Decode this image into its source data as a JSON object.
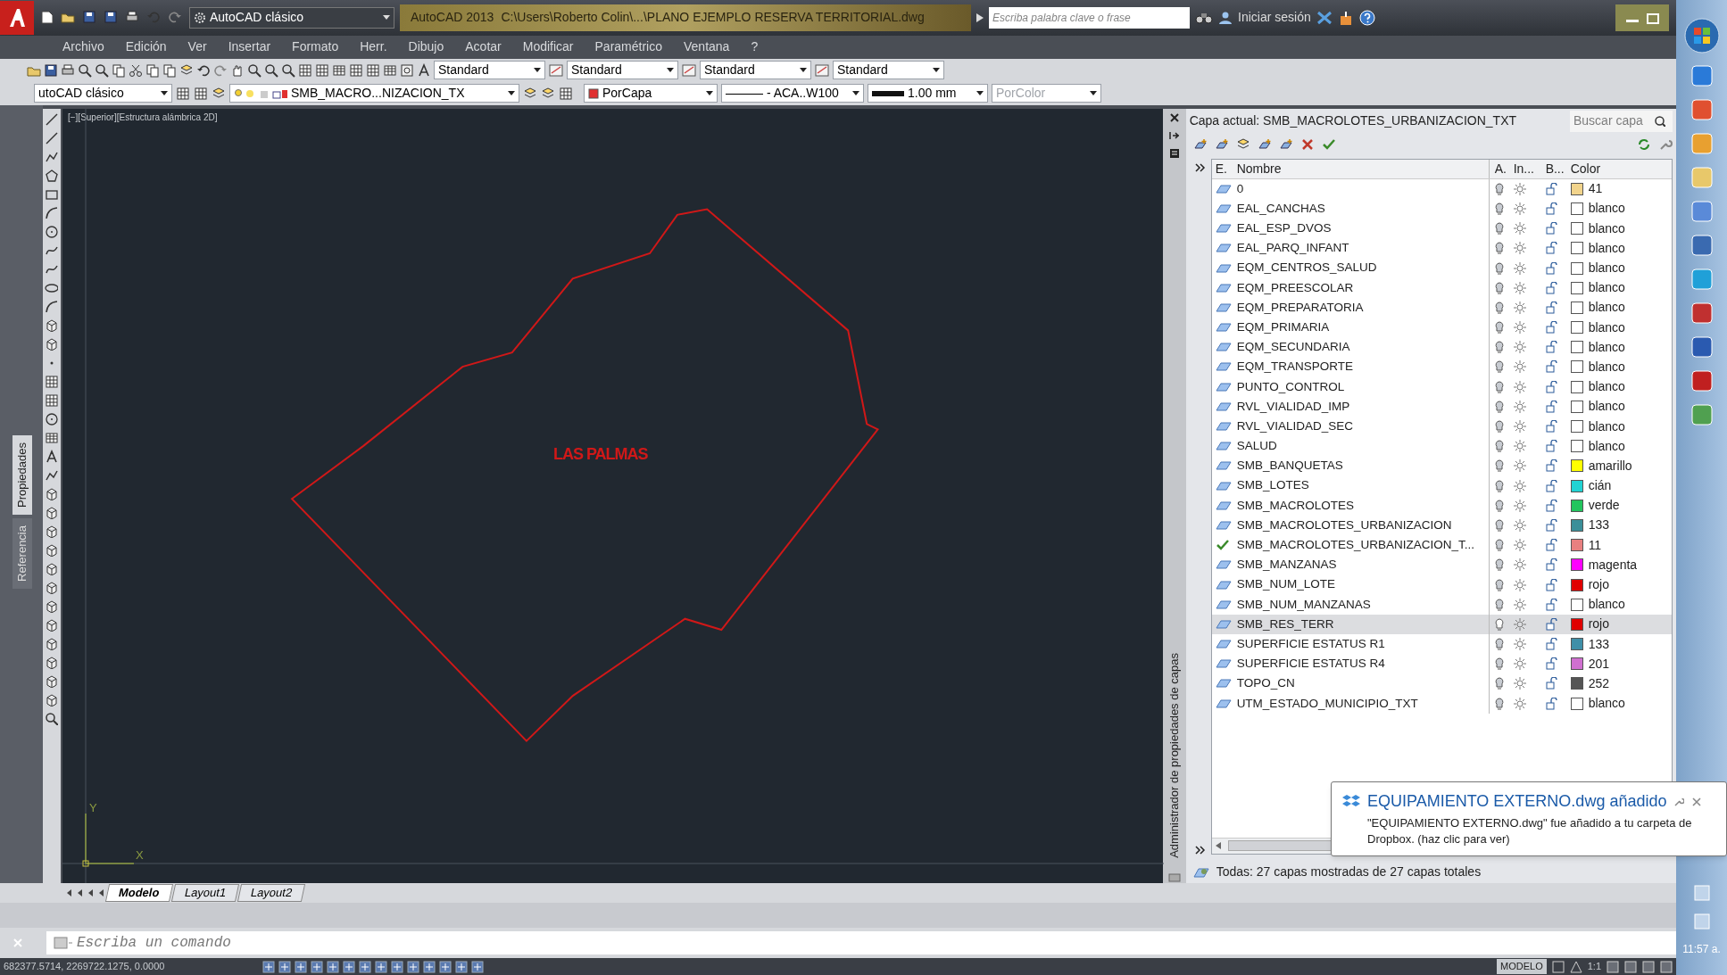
{
  "title_bar": {
    "workspace": "AutoCAD clásico",
    "app": "AutoCAD 2013",
    "file": "C:\\Users\\Roberto Colin\\...\\PLANO EJEMPLO RESERVA TERRITORIAL.dwg",
    "search_placeholder": "Escriba palabra clave o frase",
    "sign_in": "Iniciar sesión"
  },
  "menu": [
    "Archivo",
    "Edición",
    "Ver",
    "Insertar",
    "Formato",
    "Herr.",
    "Dibujo",
    "Acotar",
    "Modificar",
    "Paramétrico",
    "Ventana",
    "?"
  ],
  "toolbar_1": {
    "styles": [
      "Standard",
      "Standard",
      "Standard",
      "Standard"
    ]
  },
  "toolbar_2": {
    "workspace": "utoCAD clásico",
    "layer": "SMB_MACRO...NIZACION_TX",
    "color_control": "PorCapa",
    "linetype": "——— - ACA..W100",
    "lineweight": "1.00 mm",
    "plot_style": {
      "label": "PorColor",
      "disabled": true
    }
  },
  "side_tabs": [
    {
      "label": "Propiedades",
      "selected": true
    },
    {
      "label": "Referencia",
      "selected": false
    }
  ],
  "viewport": {
    "label": "[−][Superior][Estructura alámbrica 2D]",
    "drawing_text": "LAS PALMAS",
    "y_axis": "Y",
    "x_axis": "X"
  },
  "layer_panel": {
    "side_title": "Administrador de propiedades de capas",
    "current": "Capa actual: SMB_MACROLOTES_URBANIZACION_TXT",
    "search_placeholder": "Buscar capa",
    "columns": [
      "E.",
      "Nombre",
      "A.",
      "In...",
      "B...",
      "Color"
    ],
    "layers": [
      {
        "name": "0",
        "color": "#f2d48c",
        "color_name": "41",
        "current": false,
        "selected": false
      },
      {
        "name": "EAL_CANCHAS",
        "color": "#ffffff",
        "color_name": "blanco",
        "current": false,
        "selected": false
      },
      {
        "name": "EAL_ESP_DVOS",
        "color": "#ffffff",
        "color_name": "blanco",
        "current": false,
        "selected": false
      },
      {
        "name": "EAL_PARQ_INFANT",
        "color": "#ffffff",
        "color_name": "blanco",
        "current": false,
        "selected": false
      },
      {
        "name": "EQM_CENTROS_SALUD",
        "color": "#ffffff",
        "color_name": "blanco",
        "current": false,
        "selected": false
      },
      {
        "name": "EQM_PREESCOLAR",
        "color": "#ffffff",
        "color_name": "blanco",
        "current": false,
        "selected": false
      },
      {
        "name": "EQM_PREPARATORIA",
        "color": "#ffffff",
        "color_name": "blanco",
        "current": false,
        "selected": false
      },
      {
        "name": "EQM_PRIMARIA",
        "color": "#ffffff",
        "color_name": "blanco",
        "current": false,
        "selected": false
      },
      {
        "name": "EQM_SECUNDARIA",
        "color": "#ffffff",
        "color_name": "blanco",
        "current": false,
        "selected": false
      },
      {
        "name": "EQM_TRANSPORTE",
        "color": "#ffffff",
        "color_name": "blanco",
        "current": false,
        "selected": false
      },
      {
        "name": "PUNTO_CONTROL",
        "color": "#ffffff",
        "color_name": "blanco",
        "current": false,
        "selected": false
      },
      {
        "name": "RVL_VIALIDAD_IMP",
        "color": "#ffffff",
        "color_name": "blanco",
        "current": false,
        "selected": false
      },
      {
        "name": "RVL_VIALIDAD_SEC",
        "color": "#ffffff",
        "color_name": "blanco",
        "current": false,
        "selected": false
      },
      {
        "name": "SALUD",
        "color": "#ffffff",
        "color_name": "blanco",
        "current": false,
        "selected": false
      },
      {
        "name": "SMB_BANQUETAS",
        "color": "#ffff00",
        "color_name": "amarillo",
        "current": false,
        "selected": false
      },
      {
        "name": "SMB_LOTES",
        "color": "#22d3d3",
        "color_name": "cián",
        "current": false,
        "selected": false
      },
      {
        "name": "SMB_MACROLOTES",
        "color": "#22c55e",
        "color_name": "verde",
        "current": false,
        "selected": false
      },
      {
        "name": "SMB_MACROLOTES_URBANIZACION",
        "color": "#3b8f99",
        "color_name": "133",
        "current": false,
        "selected": false
      },
      {
        "name": "SMB_MACROLOTES_URBANIZACION_T...",
        "color": "#e88080",
        "color_name": "11",
        "current": true,
        "selected": false
      },
      {
        "name": "SMB_MANZANAS",
        "color": "#ff00ff",
        "color_name": "magenta",
        "current": false,
        "selected": false
      },
      {
        "name": "SMB_NUM_LOTE",
        "color": "#e00000",
        "color_name": "rojo",
        "current": false,
        "selected": false
      },
      {
        "name": "SMB_NUM_MANZANAS",
        "color": "#ffffff",
        "color_name": "blanco",
        "current": false,
        "selected": false
      },
      {
        "name": "SMB_RES_TERR",
        "color": "#e00000",
        "color_name": "rojo",
        "current": false,
        "selected": true
      },
      {
        "name": "SUPERFICIE ESTATUS R1",
        "color": "#3f8fa8",
        "color_name": "133",
        "current": false,
        "selected": false
      },
      {
        "name": "SUPERFICIE ESTATUS R4",
        "color": "#d070d0",
        "color_name": "201",
        "current": false,
        "selected": false
      },
      {
        "name": "TOPO_CN",
        "color": "#555555",
        "color_name": "252",
        "current": false,
        "selected": false
      },
      {
        "name": "UTM_ESTADO_MUNICIPIO_TXT",
        "color": "#ffffff",
        "color_name": "blanco",
        "current": false,
        "selected": false
      }
    ],
    "footer": "Todas: 27 capas mostradas de 27 capas totales"
  },
  "notification": {
    "title": "EQUIPAMIENTO EXTERNO.dwg añadido",
    "body": "\"EQUIPAMIENTO EXTERNO.dwg\" fue añadido a tu carpeta de Dropbox. (haz clic para ver)"
  },
  "layout_tabs": [
    {
      "label": "Modelo",
      "selected": true
    },
    {
      "label": "Layout1",
      "selected": false
    },
    {
      "label": "Layout2",
      "selected": false
    }
  ],
  "command_line": {
    "placeholder": "Escriba un comando"
  },
  "status_bar": {
    "coordinates": "682377.5714, 2269722.1275, 0.0000",
    "space": "MODELO",
    "scale": "1:1"
  },
  "taskbar": {
    "clock": "11:57 a."
  }
}
